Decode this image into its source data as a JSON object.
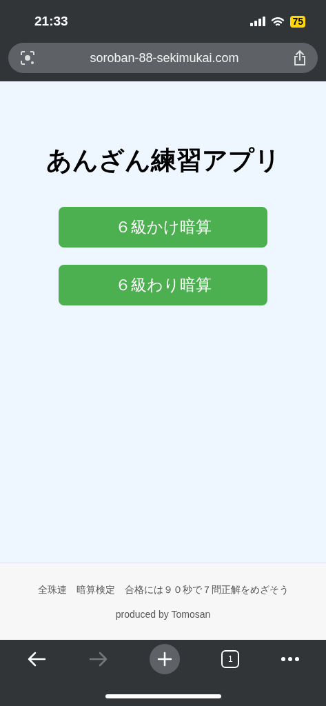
{
  "status_bar": {
    "time": "21:33",
    "battery": "75"
  },
  "address_bar": {
    "url": "soroban-88-sekimukai.com"
  },
  "page": {
    "title": "あんざん練習アプリ",
    "buttons": [
      "６級かけ暗算",
      "６級わり暗算"
    ]
  },
  "footer": {
    "note": "全珠連　暗算検定　合格には９０秒で７問正解をめざそう",
    "credit": "produced by Tomosan"
  },
  "toolbar": [
    {
      "kind": "back",
      "disabled": false
    },
    {
      "kind": "forward",
      "disabled": true
    },
    {
      "kind": "new-tab",
      "disabled": false
    },
    {
      "kind": "tabs",
      "disabled": false,
      "count": "1"
    },
    {
      "kind": "more",
      "disabled": false
    }
  ]
}
